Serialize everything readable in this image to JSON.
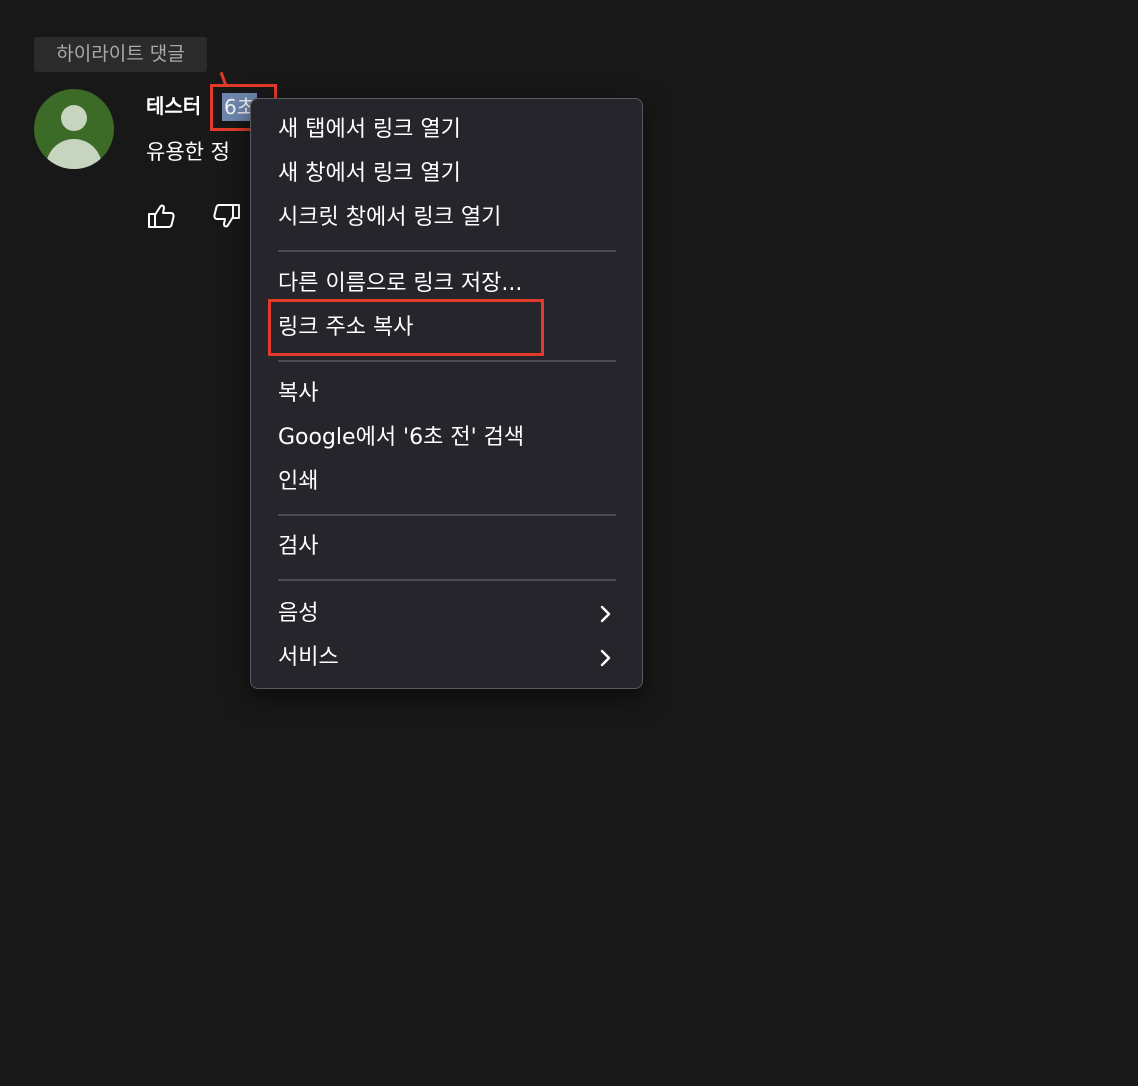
{
  "section_label": "하이라이트 댓글",
  "comment": {
    "author": "테스터",
    "timestamp": "6초",
    "text": "유용한 정"
  },
  "context_menu": {
    "group1": [
      "새 탭에서 링크 열기",
      "새 창에서 링크 열기",
      "시크릿 창에서 링크 열기"
    ],
    "group2": [
      "다른 이름으로 링크 저장...",
      "링크 주소 복사"
    ],
    "group3": [
      "복사",
      "Google에서 '6초 전' 검색",
      "인쇄"
    ],
    "group4": [
      "검사"
    ],
    "group5": [
      "음성",
      "서비스"
    ]
  },
  "colors": {
    "background": "#181818",
    "menu_background": "#27252c",
    "annotation": "#e23a2a",
    "avatar": "#3b6b26",
    "selection": "#6e86ad"
  },
  "icons": [
    "thumbs-up-icon",
    "thumbs-down-icon",
    "chevron-right-icon",
    "avatar-icon"
  ]
}
